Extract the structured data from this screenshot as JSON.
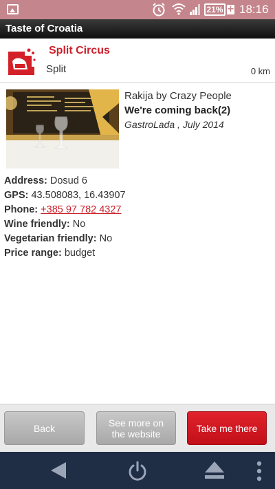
{
  "status_bar": {
    "battery": "21%",
    "battery_plus": "+",
    "time": "18:16"
  },
  "app": {
    "title": "Taste of Croatia"
  },
  "place": {
    "name": "Split Circus",
    "city": "Split",
    "distance": "0 km"
  },
  "review": {
    "source": "Rakija by Crazy People",
    "title": "We're coming back(2)",
    "meta": "GastroLada , July 2014"
  },
  "details": {
    "address_label": "Address:",
    "address_value": "Dosud 6",
    "gps_label": "GPS:",
    "gps_value": "43.508083, 16.43907",
    "phone_label": "Phone:",
    "phone_value": "+385 97 782 4327",
    "wine_label": "Wine friendly:",
    "wine_value": "No",
    "veg_label": "Vegetarian friendly:",
    "veg_value": "No",
    "price_label": "Price range:",
    "price_value": "budget"
  },
  "buttons": {
    "back": "Back",
    "website_line1": "See more on",
    "website_line2": "the website",
    "take_me": "Take me there"
  },
  "colors": {
    "accent": "#cc1f2a",
    "status_bar": "#c4868c",
    "nav_bar": "#1f2d45"
  }
}
